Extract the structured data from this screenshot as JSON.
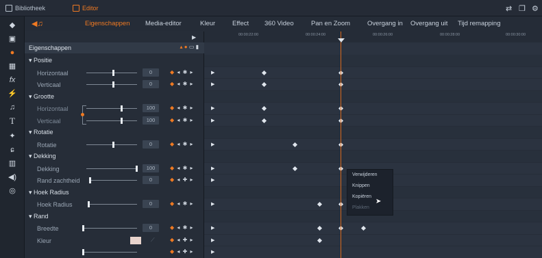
{
  "topbar": {
    "library_tab": "Bibliotheek",
    "editor_tab": "Editor",
    "right_icons": [
      "share-icon",
      "window-icon",
      "settings-icon"
    ]
  },
  "header": {
    "tabs": [
      "Eigenschappen",
      "Media-editor",
      "Kleur",
      "Effect",
      "360 Video",
      "Pan en Zoom",
      "Overgang in",
      "Overgang uit",
      "Tijd remapping"
    ],
    "active_tab": "Eigenschappen"
  },
  "left_strip_icons": [
    "layers-icon",
    "media-icon",
    "color-icon",
    "photo-icon",
    "fx-icon",
    "transition-icon",
    "music-icon",
    "text-icon",
    "magic-icon",
    "motion-icon",
    "grid-icon",
    "audio-icon",
    "disc-icon"
  ],
  "panel": {
    "title": "Eigenschappen",
    "groups": [
      {
        "label": "Positie",
        "props": [
          {
            "label": "Horizontaal",
            "value": "0"
          },
          {
            "label": "Verticaal",
            "value": "0"
          }
        ]
      },
      {
        "label": "Grootte",
        "props": [
          {
            "label": "Horizontaal",
            "value": "100"
          },
          {
            "label": "Verticaal",
            "value": "100"
          }
        ]
      },
      {
        "label": "Rotatie",
        "props": [
          {
            "label": "Rotatie",
            "value": "0"
          }
        ]
      },
      {
        "label": "Dekking",
        "props": [
          {
            "label": "Dekking",
            "value": "100"
          },
          {
            "label": "Rand zachtheid",
            "value": "0"
          }
        ]
      },
      {
        "label": "Hoek Radius",
        "props": [
          {
            "label": "Hoek Radius",
            "value": "0"
          }
        ]
      },
      {
        "label": "Rand",
        "props": [
          {
            "label": "Breedte",
            "value": "0"
          },
          {
            "label": "Kleur",
            "value": ""
          }
        ]
      }
    ]
  },
  "timeline": {
    "ticks": [
      "00:00:22:00",
      "00:00:24:00",
      "00:00:26:00",
      "00:00:28:00",
      "00:00:30:00"
    ]
  },
  "context_menu": {
    "items": [
      "Verwijderen",
      "Knippen",
      "Kopiëren",
      "Plakken"
    ],
    "disabled": [
      "Plakken"
    ]
  },
  "colors": {
    "accent": "#f07a22",
    "background": "#1e2430",
    "panel": "#262d38",
    "timeline": "#2b3340"
  }
}
